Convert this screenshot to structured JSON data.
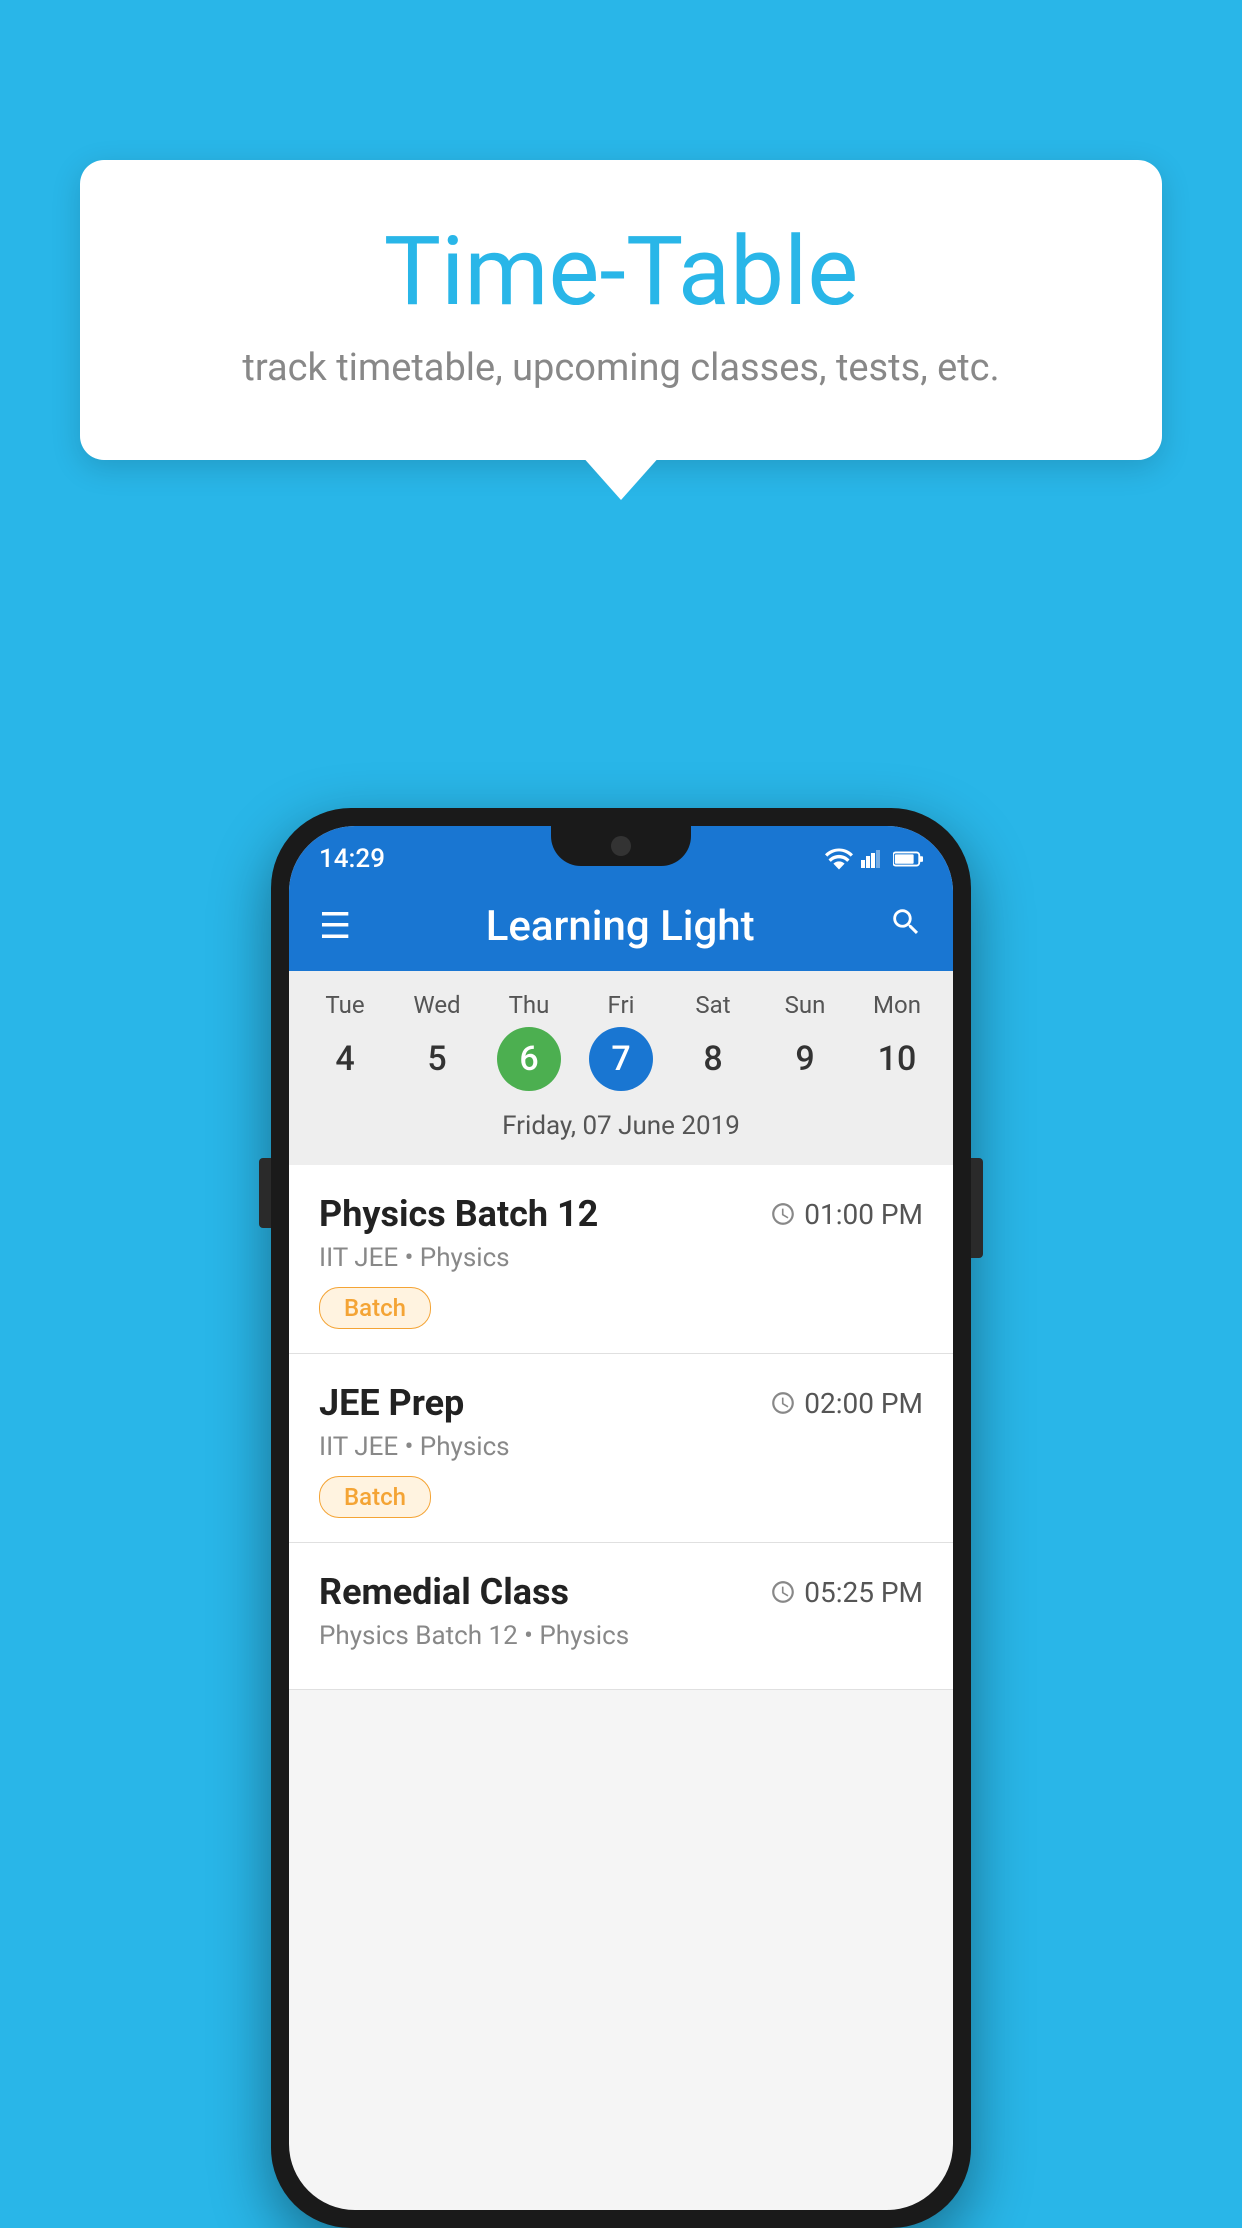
{
  "background_color": "#29B6E8",
  "tooltip": {
    "title": "Time-Table",
    "subtitle": "track timetable, upcoming classes, tests, etc."
  },
  "phone": {
    "status_bar": {
      "time": "14:29"
    },
    "app_bar": {
      "title": "Learning Light"
    },
    "calendar": {
      "days": [
        {
          "label": "Tue",
          "number": "4",
          "state": "normal"
        },
        {
          "label": "Wed",
          "number": "5",
          "state": "normal"
        },
        {
          "label": "Thu",
          "number": "6",
          "state": "today"
        },
        {
          "label": "Fri",
          "number": "7",
          "state": "selected"
        },
        {
          "label": "Sat",
          "number": "8",
          "state": "normal"
        },
        {
          "label": "Sun",
          "number": "9",
          "state": "normal"
        },
        {
          "label": "Mon",
          "number": "10",
          "state": "normal"
        }
      ],
      "selected_date_label": "Friday, 07 June 2019"
    },
    "schedule": [
      {
        "title": "Physics Batch 12",
        "time": "01:00 PM",
        "subtitle": "IIT JEE • Physics",
        "tag": "Batch"
      },
      {
        "title": "JEE Prep",
        "time": "02:00 PM",
        "subtitle": "IIT JEE • Physics",
        "tag": "Batch"
      },
      {
        "title": "Remedial Class",
        "time": "05:25 PM",
        "subtitle": "Physics Batch 12 • Physics",
        "tag": ""
      }
    ]
  }
}
